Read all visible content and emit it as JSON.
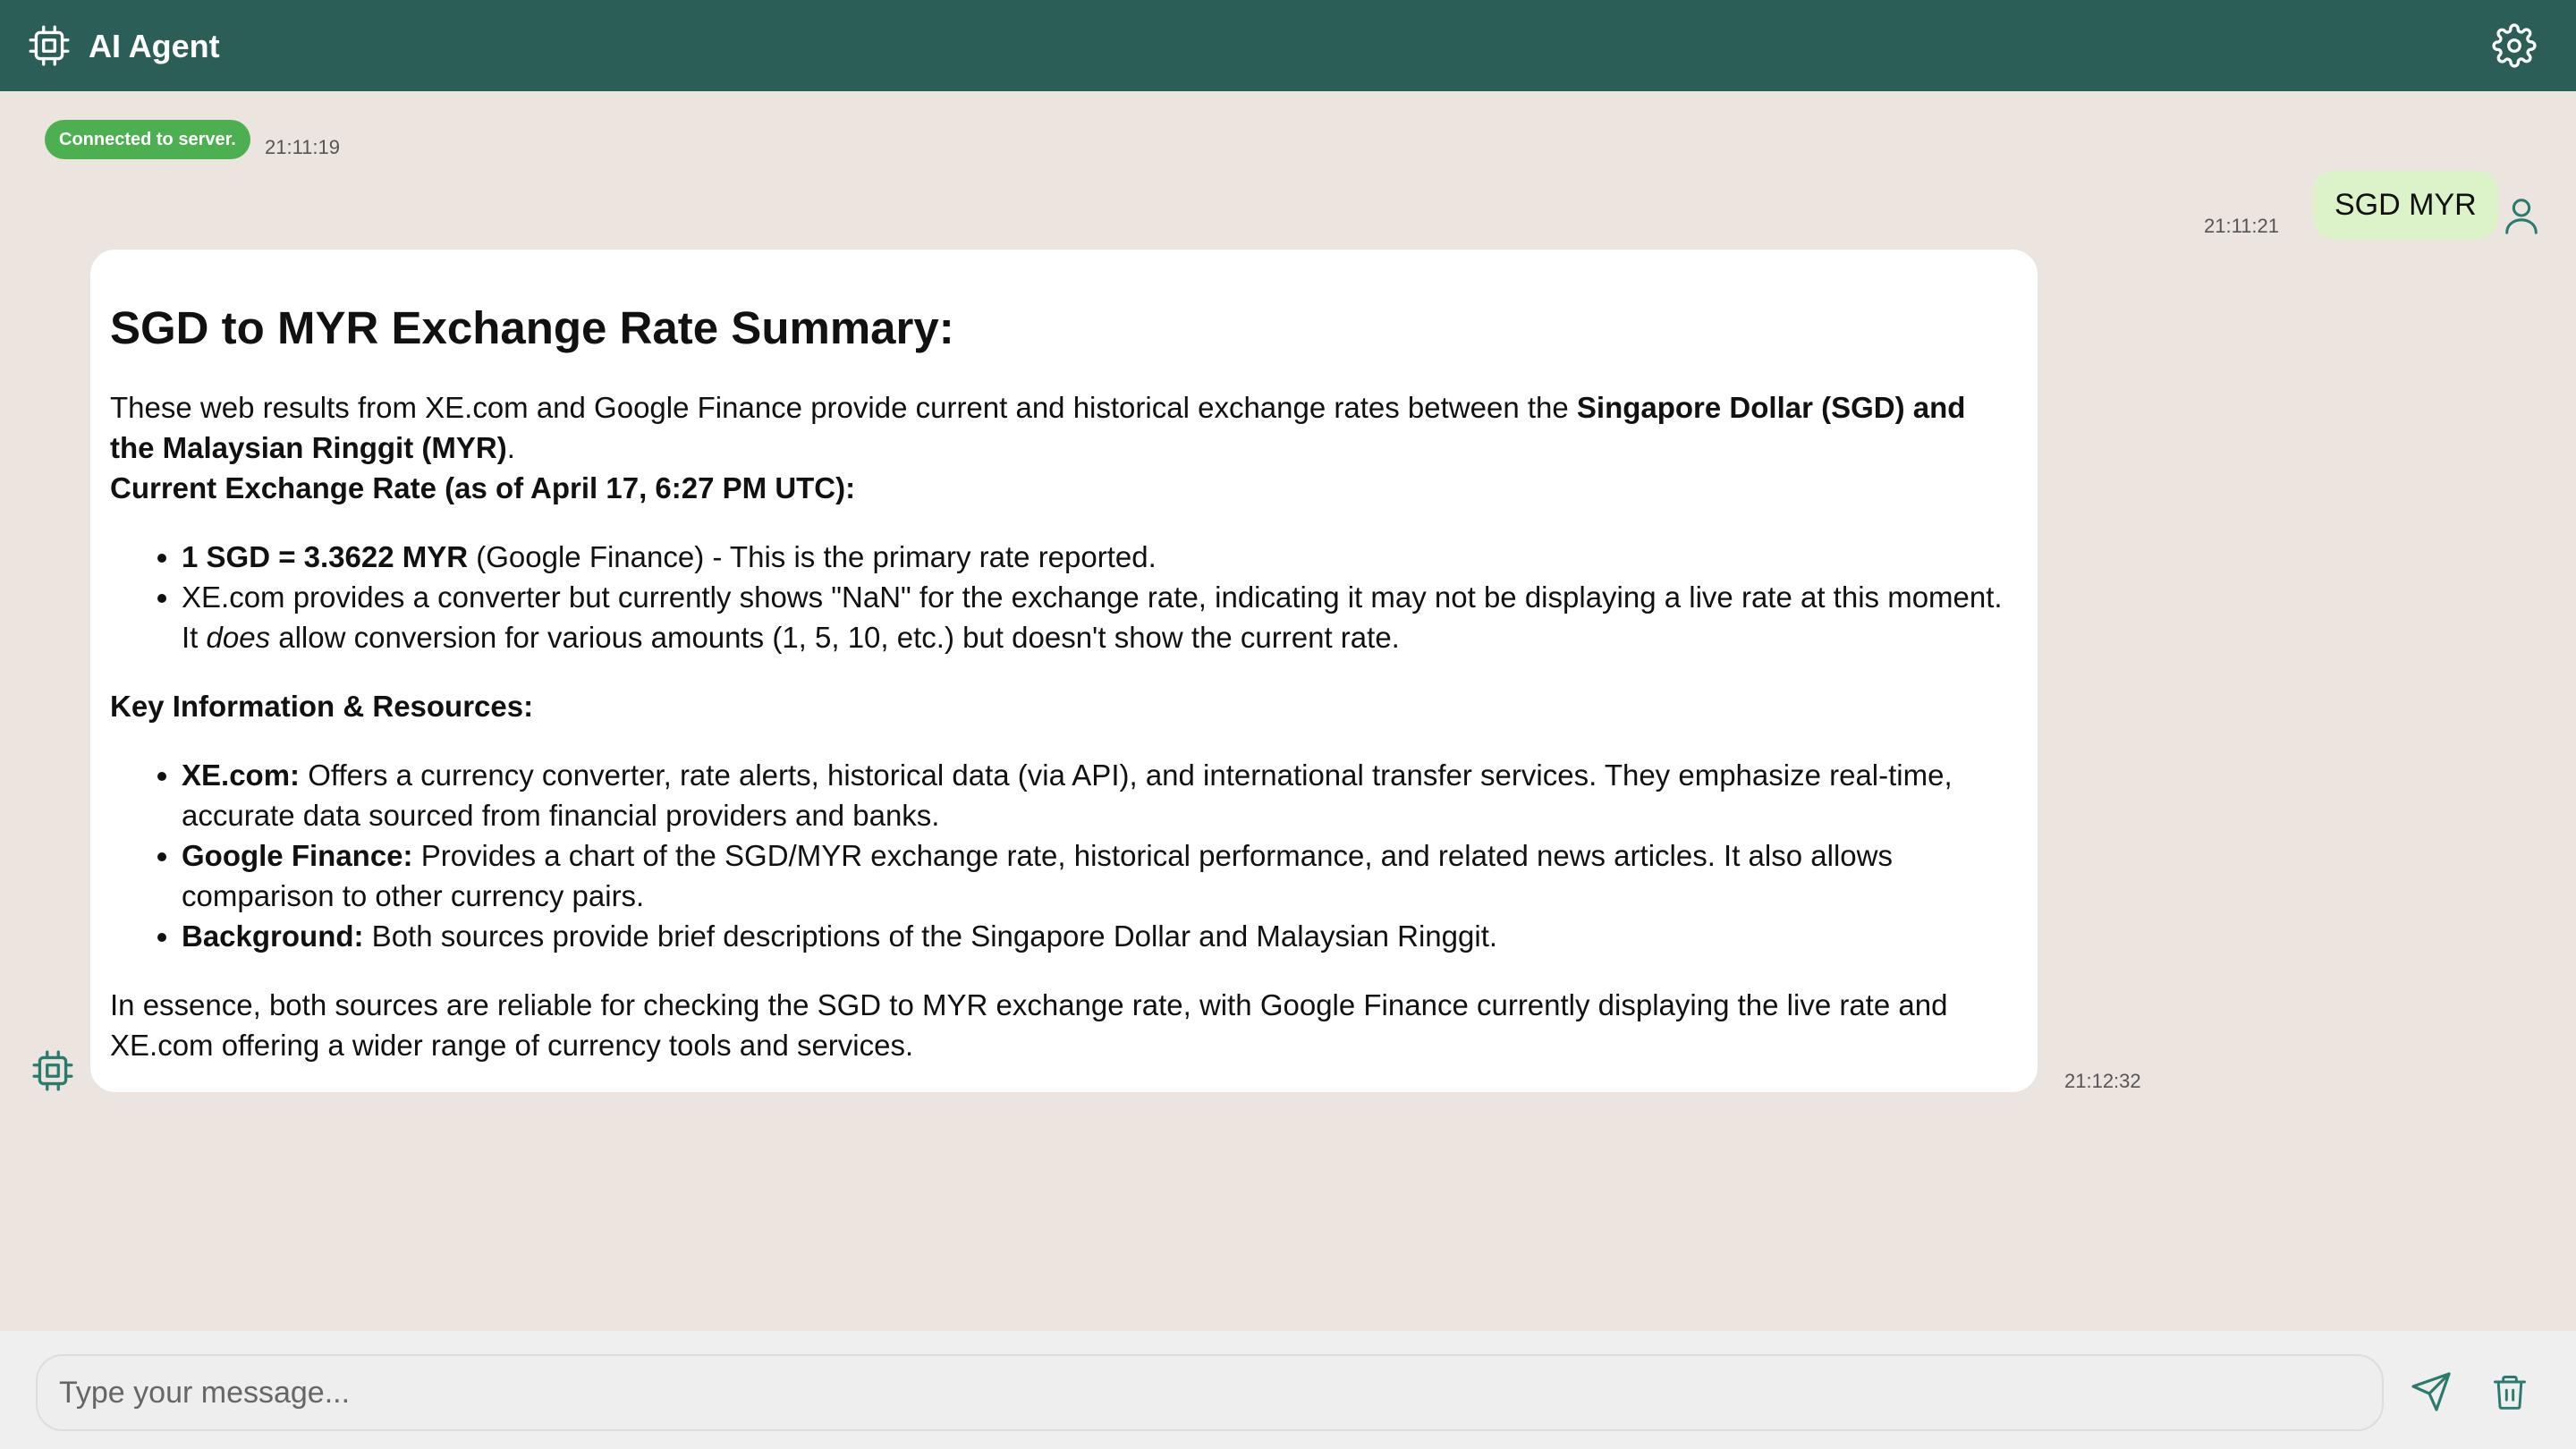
{
  "app": {
    "title": "AI Agent"
  },
  "status": {
    "label": "Connected to server.",
    "time": "21:11:19"
  },
  "user_message": {
    "text": "SGD MYR",
    "time": "21:11:21"
  },
  "agent_message": {
    "time": "21:12:32",
    "heading": "SGD to MYR Exchange Rate Summary:",
    "intro_plain": "These web results from XE.com and Google Finance provide current and historical exchange rates between the ",
    "intro_bold": "Singapore Dollar (SGD) and the Malaysian Ringgit (MYR)",
    "intro_end": ".",
    "current_heading": "Current Exchange Rate (as of April 17, 6:27 PM UTC):",
    "bullets1": [
      {
        "bold": "1 SGD = 3.3622 MYR",
        "text": " (Google Finance) - This is the primary rate reported."
      },
      {
        "text_a": "XE.com provides a converter but currently shows \"NaN\" for the exchange rate, indicating it may not be displaying a live rate at this moment. It ",
        "italic": "does",
        "text_b": " allow conversion for various amounts (1, 5, 10, etc.) but doesn't show the current rate."
      }
    ],
    "key_heading": "Key Information & Resources:",
    "bullets2": [
      {
        "bold": "XE.com:",
        "text": " Offers a currency converter, rate alerts, historical data (via API), and international transfer services. They emphasize real-time, accurate data sourced from financial providers and banks."
      },
      {
        "bold": "Google Finance:",
        "text": " Provides a chart of the SGD/MYR exchange rate, historical performance, and related news articles. It also allows comparison to other currency pairs."
      },
      {
        "bold": "Background:",
        "text": " Both sources provide brief descriptions of the Singapore Dollar and Malaysian Ringgit."
      }
    ],
    "conclusion": "In essence, both sources are reliable for checking the SGD to MYR exchange rate, with Google Finance currently displaying the live rate and XE.com offering a wider range of currency tools and services."
  },
  "composer": {
    "placeholder": "Type your message..."
  },
  "icons": {
    "logo": "cpu-chip-icon",
    "settings": "gear-icon",
    "user": "user-icon",
    "agent": "cpu-chip-icon",
    "send": "send-icon",
    "delete": "trash-icon"
  },
  "colors": {
    "header": "#2a5e56",
    "background": "#ece5df",
    "status": "#4caf50",
    "user_bubble": "#dcf2c8",
    "agent_bubble": "#ffffff"
  }
}
